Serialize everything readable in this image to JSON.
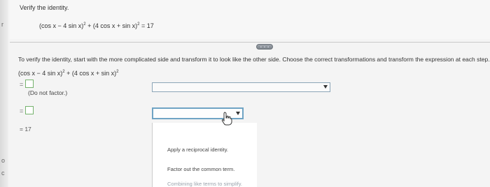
{
  "left_marks": [
    "r",
    "o",
    "c"
  ],
  "question": {
    "title": "Verify the identity.",
    "equation": {
      "term1": "(cos x − 4 sin x)",
      "exp": "2",
      "plus": " + ",
      "term2": "(4 cos x + sin x)",
      "rhs": " = 17"
    }
  },
  "instructions": "To verify the identity, start with the more complicated side and transform it to look like the other side. Choose the correct transformations and transform the expression at each step.",
  "start_expression": {
    "term1": "(cos x − 4 sin x)",
    "exp": "2",
    "plus": " + ",
    "term2": "(4 cos x + sin x)"
  },
  "steps": {
    "eq_sign": "=",
    "note": "(Do not factor.)",
    "final": "= 17"
  },
  "dropdown": {
    "options": [
      "Apply a reciprocal identity.",
      "Factor out the common term.",
      "Combining like terms to simplify."
    ]
  }
}
